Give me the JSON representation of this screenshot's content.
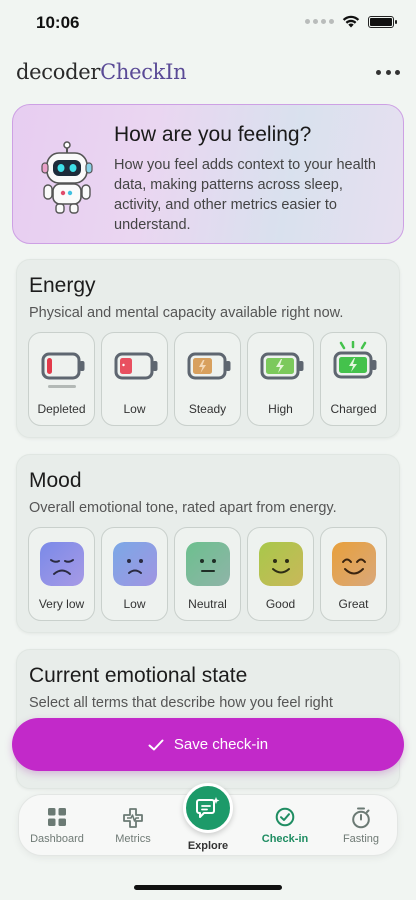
{
  "status": {
    "time": "10:06"
  },
  "header": {
    "brand_main": "decoder",
    "brand_accent": "CheckIn",
    "more_icon": "ellipsis-icon"
  },
  "hero": {
    "title": "How are you feeling?",
    "body": "How you feel adds context to your health data, making patterns across sleep, activity, and other metrics easier to understand.",
    "icon": "robot-mascot"
  },
  "energy": {
    "title": "Energy",
    "subtitle": "Physical and mental capacity available right now.",
    "options": [
      {
        "label": "Depleted",
        "icon": "battery-empty-icon",
        "color": "#e23a4a"
      },
      {
        "label": "Low",
        "icon": "battery-low-icon",
        "color": "#e85060"
      },
      {
        "label": "Steady",
        "icon": "battery-half-icon",
        "color": "#d8a05e"
      },
      {
        "label": "High",
        "icon": "battery-high-icon",
        "color": "#7cc95c"
      },
      {
        "label": "Charged",
        "icon": "battery-full-icon",
        "color": "#44c24c"
      }
    ]
  },
  "mood": {
    "title": "Mood",
    "subtitle": "Overall emotional tone, rated apart from energy.",
    "options": [
      {
        "label": "Very low",
        "icon": "very-sad-face-icon",
        "color": "#8a8fe6"
      },
      {
        "label": "Low",
        "icon": "sad-face-icon",
        "color": "#8a9ae6"
      },
      {
        "label": "Neutral",
        "icon": "neutral-face-icon",
        "color": "#7fbf8b"
      },
      {
        "label": "Good",
        "icon": "smile-face-icon",
        "color": "#b8c34a"
      },
      {
        "label": "Great",
        "icon": "happy-face-icon",
        "color": "#e0a14c"
      }
    ]
  },
  "emotional_state": {
    "title": "Current emotional state",
    "subtitle": "Select all terms that describe how you feel right"
  },
  "save_button": {
    "label": "Save check-in",
    "icon": "check-icon",
    "color": "#c229c9"
  },
  "tabbar": {
    "tabs": [
      {
        "label": "Dashboard",
        "icon": "grid-icon"
      },
      {
        "label": "Metrics",
        "icon": "metrics-icon"
      },
      {
        "label": "Explore",
        "icon": "chat-sparkle-icon"
      },
      {
        "label": "Check-in",
        "icon": "check-circle-icon",
        "active": true
      },
      {
        "label": "Fasting",
        "icon": "stopwatch-icon"
      }
    ],
    "accent": "#1f8d62"
  }
}
